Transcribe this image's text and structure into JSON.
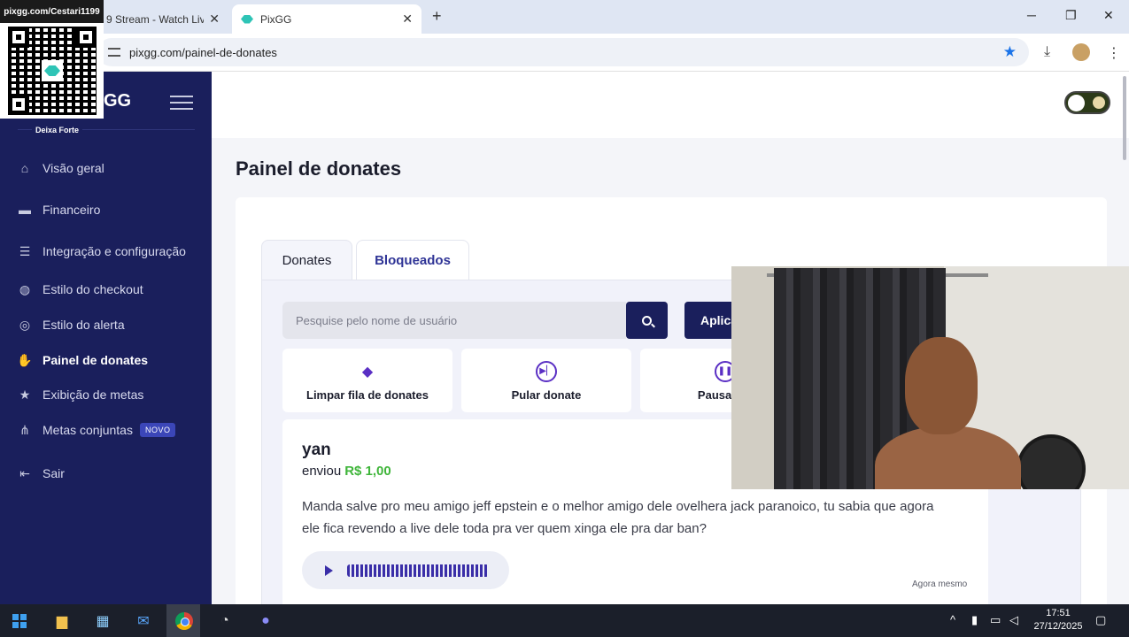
{
  "browser": {
    "tabs": [
      {
        "title": "9 Stream - Watch Liv",
        "active": false
      },
      {
        "title": "PixGG",
        "active": true
      }
    ],
    "url": "pixgg.com/painel-de-donates",
    "window_controls": {
      "minimize": "─",
      "maximize": "❐",
      "close": "✕"
    }
  },
  "overlay": {
    "qr_caption": "pixgg.com/Cestari1199"
  },
  "sidebar": {
    "brand_tail": "GG",
    "tagline": "Deixa Forte",
    "items": [
      {
        "label": "Visão geral",
        "icon": "home-icon"
      },
      {
        "label": "Financeiro",
        "icon": "wallet-icon"
      },
      {
        "label": "Integração e configuração",
        "icon": "settings-icon"
      },
      {
        "label": "Estilo do checkout",
        "icon": "palette-icon"
      },
      {
        "label": "Estilo do alerta",
        "icon": "alert-style-icon"
      },
      {
        "label": "Painel de donates",
        "icon": "donate-hand-icon",
        "active": true
      },
      {
        "label": "Exibição de metas",
        "icon": "star-icon"
      },
      {
        "label": "Metas conjuntas",
        "icon": "share-icon",
        "badge": "NOVO"
      },
      {
        "label": "Sair",
        "icon": "logout-icon"
      }
    ]
  },
  "main": {
    "title": "Painel de donates",
    "tabs": [
      {
        "label": "Donates",
        "active": true
      },
      {
        "label": "Bloqueados",
        "active": false
      }
    ],
    "search": {
      "placeholder": "Pesquise pelo nome de usuário"
    },
    "apply_label": "Aplica",
    "actions": [
      {
        "label": "Limpar fila de donates",
        "icon": "eraser-icon"
      },
      {
        "label": "Pular donate",
        "icon": "skip-icon"
      },
      {
        "label": "Pausar os",
        "icon": "pause-icon"
      }
    ],
    "donate": {
      "user": "yan",
      "sent_prefix": "enviou",
      "amount": "R$ 1,00",
      "message": "Manda salve pro meu amigo jeff epstein e o melhor amigo dele ovelhera jack paranoico, tu sabia que agora ele fica revendo a live dele toda pra ver quem xinga ele pra dar ban?",
      "time": "Agora mesmo"
    }
  },
  "taskbar": {
    "time": "17:51",
    "date": "27/12/2025"
  },
  "colors": {
    "sidebar_bg": "#1a1f5c",
    "accent": "#5a2fc4",
    "amount_green": "#3fb53a"
  }
}
